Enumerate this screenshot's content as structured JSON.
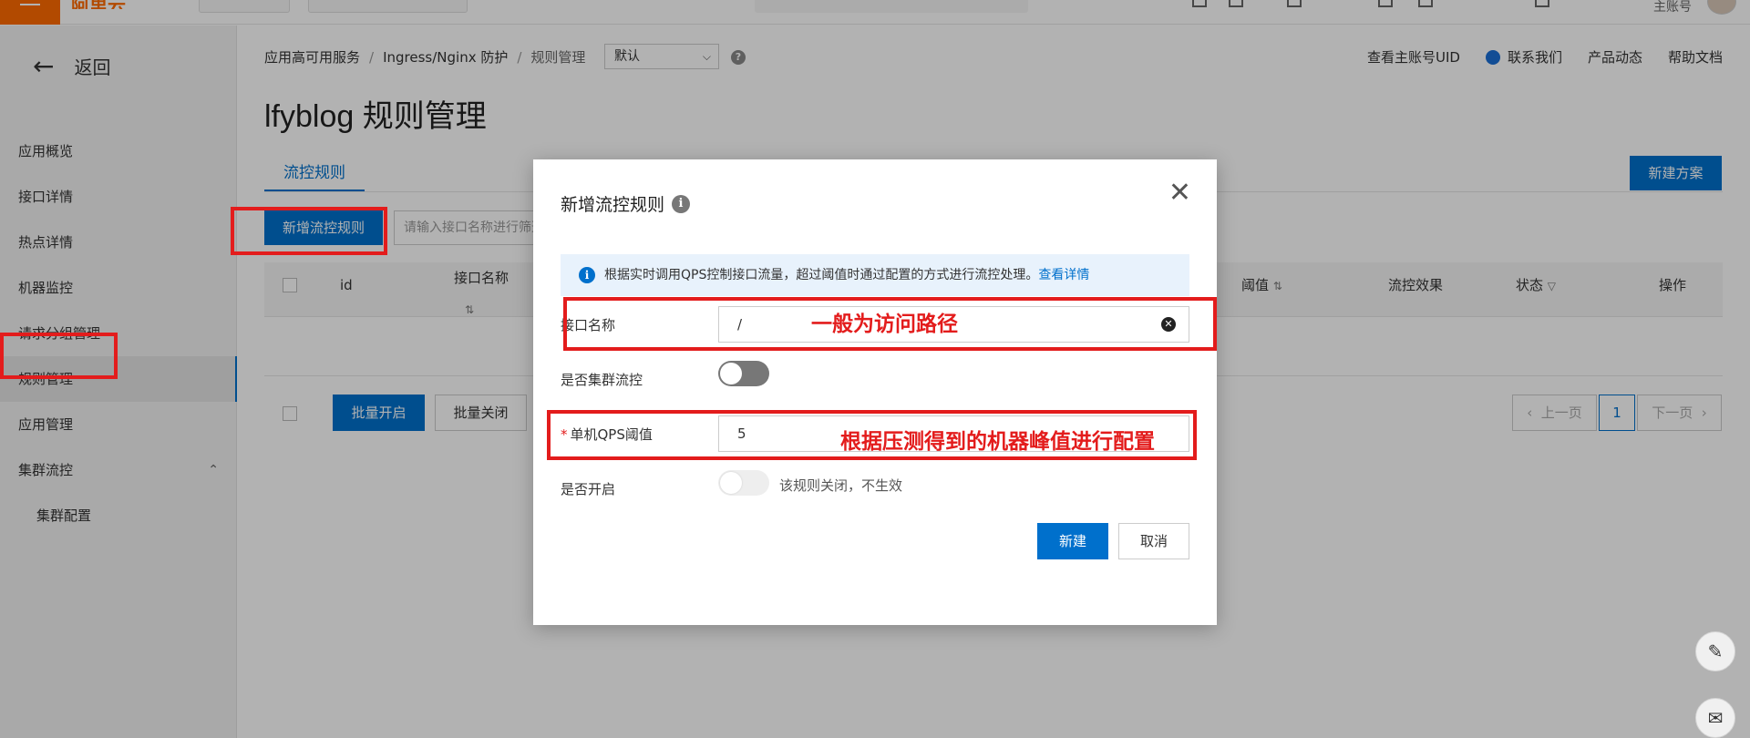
{
  "topbar": {
    "logo": "阿里云",
    "account": "主账号"
  },
  "sidebar": {
    "back_label": "返回",
    "items": [
      {
        "label": "应用概览"
      },
      {
        "label": "接口详情"
      },
      {
        "label": "热点详情"
      },
      {
        "label": "机器监控"
      },
      {
        "label": "请求分组管理"
      },
      {
        "label": "规则管理",
        "active": true
      },
      {
        "label": "应用管理"
      },
      {
        "label": "集群流控"
      },
      {
        "label": "集群配置"
      }
    ]
  },
  "header": {
    "breadcrumb": [
      "应用高可用服务",
      "Ingress/Nginx 防护",
      "规则管理"
    ],
    "env_select": "默认",
    "links": {
      "uid": "查看主账号UID",
      "contact": "联系我们",
      "news": "产品动态",
      "docs": "帮助文档"
    }
  },
  "page": {
    "title": "lfyblog 规则管理",
    "tab": "流控规则",
    "new_plan_button": "新建方案",
    "new_rule_button": "新增流控规则",
    "search_placeholder": "请输入接口名称进行筛选"
  },
  "table": {
    "columns": [
      "id",
      "接口名称",
      "阈值",
      "流控效果",
      "状态",
      "操作"
    ],
    "batch_open": "批量开启",
    "batch_close": "批量关闭"
  },
  "pagination": {
    "prev": "上一页",
    "current": "1",
    "next": "下一页"
  },
  "modal": {
    "title": "新增流控规则",
    "notice_text": "根据实时调用QPS控制接口流量，超过阈值时通过配置的方式进行流控处理。",
    "notice_link": "查看详情",
    "fields": {
      "api_name_label": "接口名称",
      "api_name_value": "/",
      "cluster_label": "是否集群流控",
      "qps_label": "单机QPS阈值",
      "qps_value": "5",
      "enable_label": "是否开启",
      "enable_hint": "该规则关闭，不生效"
    },
    "create_button": "新建",
    "cancel_button": "取消"
  },
  "annotations": {
    "path_note": "一般为访问路径",
    "qps_note": "根据压测得到的机器峰值进行配置"
  },
  "colors": {
    "primary": "#0070cc",
    "brand_orange": "#ff6a00",
    "annotation_red": "#e31c1c"
  }
}
